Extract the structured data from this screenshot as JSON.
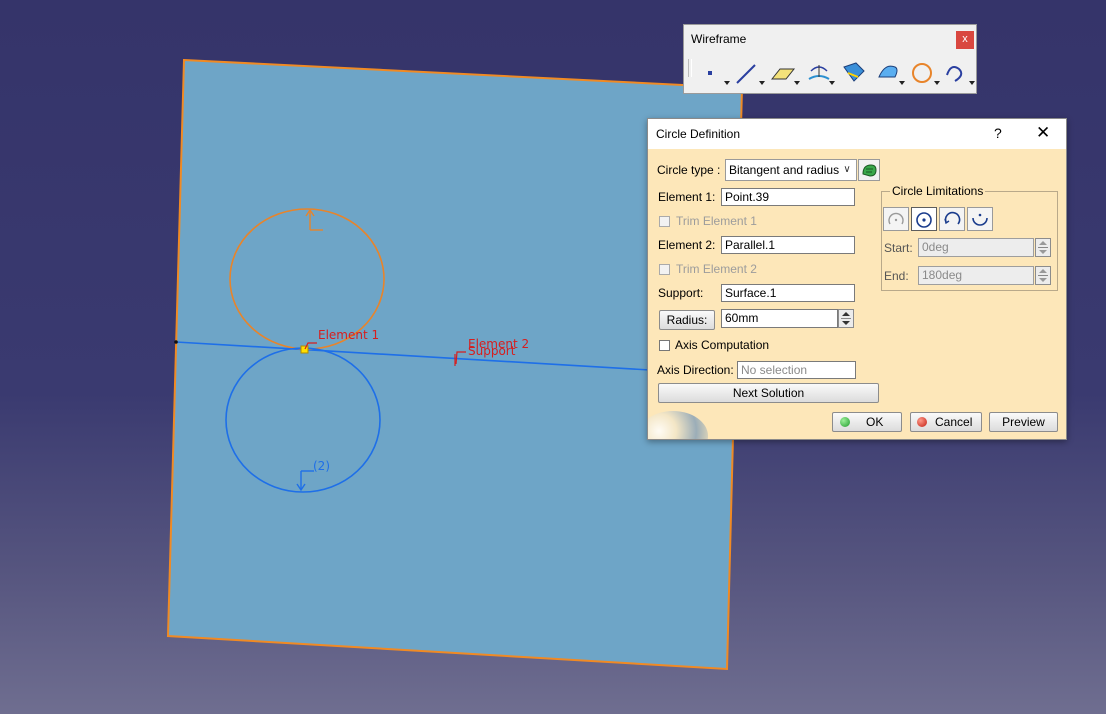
{
  "viewport": {
    "labels": {
      "element1": "Element 1",
      "element2": "Element 2",
      "support": "Support",
      "solution2": "(2)"
    },
    "colors": {
      "background": "#35346a",
      "surface_fill": "#6ea5c7",
      "surface_edge": "#f08a24",
      "orange_circle": "#e8842a",
      "blue_circle": "#1e6fe8",
      "label_red": "#d61e1e"
    }
  },
  "toolbar": {
    "title": "Wireframe",
    "close_label": "x",
    "icons": [
      "point-icon",
      "line-icon",
      "plane-icon",
      "projection-icon",
      "intersection-icon",
      "polyline-icon",
      "circle-icon",
      "spline-icon"
    ]
  },
  "dialog": {
    "title": "Circle Definition",
    "help_label": "?",
    "close_label": "✕",
    "circle_type_label": "Circle type :",
    "circle_type_value": "Bitangent and radius",
    "element1_label": "Element 1:",
    "element1_value": "Point.39",
    "trim1_label": "Trim Element 1",
    "element2_label": "Element 2:",
    "element2_value": "Parallel.1",
    "trim2_label": "Trim Element 2",
    "support_label": "Support:",
    "support_value": "Surface.1",
    "radius_button": "Radius:",
    "radius_value": "60mm",
    "axis_computation_label": "Axis Computation",
    "axis_direction_label": "Axis Direction:",
    "axis_direction_placeholder": "No selection",
    "next_solution_label": "Next Solution",
    "limits": {
      "title": "Circle Limitations",
      "start_label": "Start:",
      "start_value": "0deg",
      "end_label": "End:",
      "end_value": "180deg"
    },
    "ok_label": "OK",
    "cancel_label": "Cancel",
    "preview_label": "Preview"
  }
}
